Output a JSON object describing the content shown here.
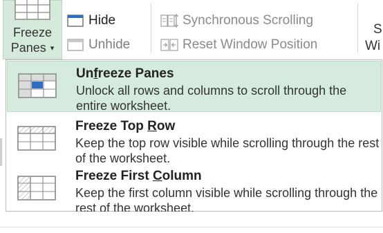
{
  "ribbon": {
    "freeze_panes": {
      "line1": "Freeze",
      "line2": "Panes",
      "caret": "▾",
      "icon": "freeze-panes-icon"
    },
    "hide": {
      "label": "Hide",
      "icon": "hide-window-icon"
    },
    "unhide": {
      "label": "Unhide",
      "icon": "unhide-window-icon"
    },
    "sync_scrolling": {
      "label": "Synchronous Scrolling",
      "icon": "synchronous-scrolling-icon"
    },
    "reset_position": {
      "label": "Reset Window Position",
      "icon": "reset-window-position-icon"
    },
    "clipped_s": "S",
    "clipped_wi": "Wi"
  },
  "menu": {
    "items": [
      {
        "title_pre": "Un",
        "title_key": "f",
        "title_post": "reeze Panes",
        "description": "Unlock all rows and columns to scroll through the entire worksheet.",
        "icon": "unfreeze-panes-icon",
        "highlighted": true
      },
      {
        "title_pre": "Freeze Top ",
        "title_key": "R",
        "title_post": "ow",
        "description": "Keep the top row visible while scrolling through the rest of the worksheet.",
        "icon": "freeze-top-row-icon",
        "highlighted": false
      },
      {
        "title_pre": "Freeze First ",
        "title_key": "C",
        "title_post": "olumn",
        "description": "Keep the first column visible while scrolling through the rest of the worksheet.",
        "icon": "freeze-first-column-icon",
        "highlighted": false
      }
    ]
  },
  "colors": {
    "highlight": "#d5ebdd",
    "accent_blue": "#2e6fc0",
    "disabled_text": "#8a8a8a"
  }
}
